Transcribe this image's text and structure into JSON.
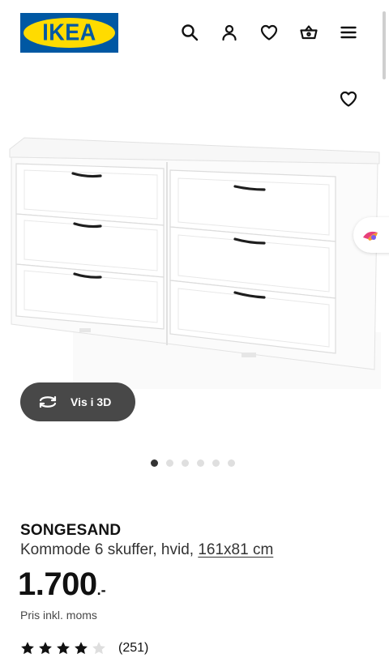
{
  "header": {
    "logo_text": "IKEA",
    "icons": [
      "search-icon",
      "user-icon",
      "heart-icon",
      "basket-icon",
      "menu-icon"
    ]
  },
  "colors": {
    "ikea_blue": "#0058a3",
    "ikea_yellow": "#ffdb00",
    "button_dark": "#484848",
    "dot_active": "#333333",
    "dot_inactive": "#dfdfdf"
  },
  "gallery": {
    "view_3d_label": "Vis i 3D",
    "image_count": 6,
    "active_image": 1
  },
  "product": {
    "name": "SONGESAND",
    "description": "Kommode 6 skuffer, hvid, ",
    "size_link": "161x81 cm",
    "price": "1.700",
    "price_suffix": ".-",
    "price_note": "Pris inkl. moms",
    "rating_value": 4,
    "rating_max": 5,
    "review_count": "(251)"
  }
}
